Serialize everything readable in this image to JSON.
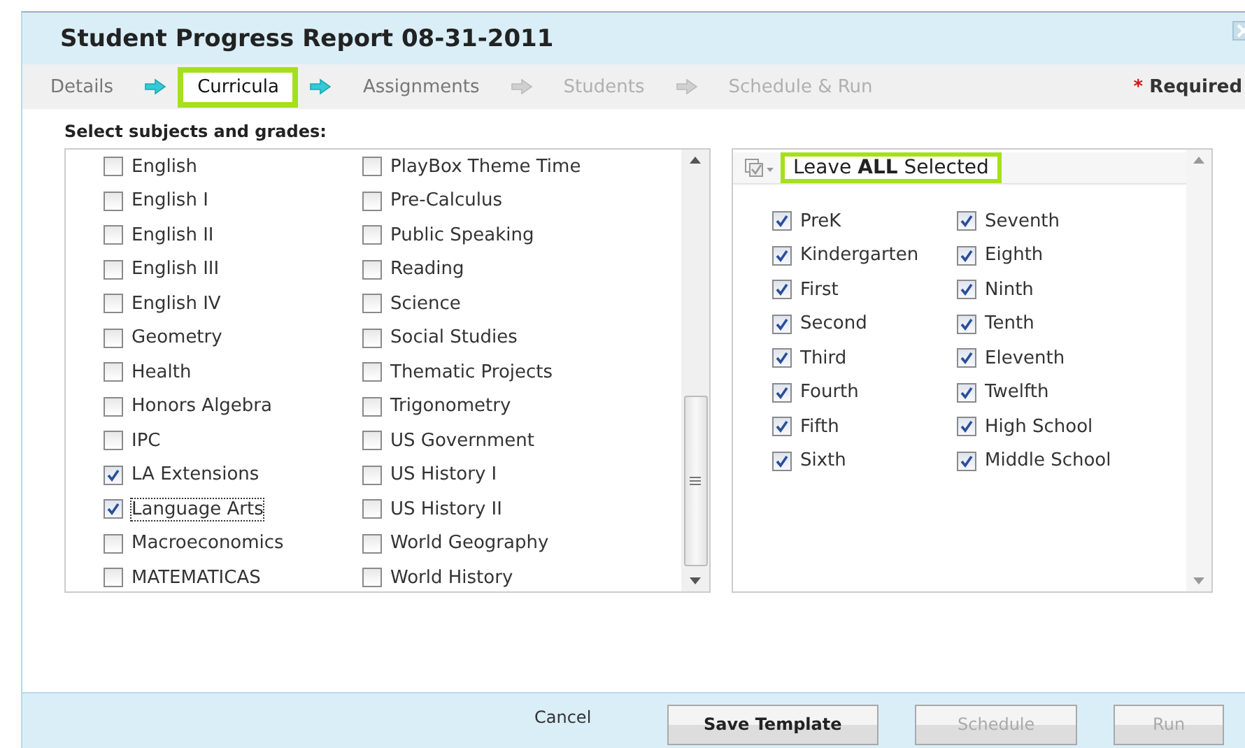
{
  "window": {
    "title": "Student Progress Report 08-31-2011"
  },
  "steps": [
    {
      "label": "Details",
      "enabled": true,
      "selected": false
    },
    {
      "label": "Curricula",
      "enabled": true,
      "selected": true
    },
    {
      "label": "Assignments",
      "enabled": true,
      "selected": false
    },
    {
      "label": "Students",
      "enabled": false,
      "selected": false
    },
    {
      "label": "Schedule & Run",
      "enabled": false,
      "selected": false
    }
  ],
  "required": {
    "mark": "*",
    "label": "Required"
  },
  "prompt": "Select subjects and grades:",
  "subjects": [
    {
      "label": "English",
      "checked": false,
      "focused": false
    },
    {
      "label": "English I",
      "checked": false,
      "focused": false
    },
    {
      "label": "English II",
      "checked": false,
      "focused": false
    },
    {
      "label": "English III",
      "checked": false,
      "focused": false
    },
    {
      "label": "English IV",
      "checked": false,
      "focused": false
    },
    {
      "label": "Geometry",
      "checked": false,
      "focused": false
    },
    {
      "label": "Health",
      "checked": false,
      "focused": false
    },
    {
      "label": "Honors Algebra",
      "checked": false,
      "focused": false
    },
    {
      "label": "IPC",
      "checked": false,
      "focused": false
    },
    {
      "label": "LA Extensions",
      "checked": true,
      "focused": false
    },
    {
      "label": "Language Arts",
      "checked": true,
      "focused": true
    },
    {
      "label": "Macroeconomics",
      "checked": false,
      "focused": false
    },
    {
      "label": "MATEMATICAS",
      "checked": false,
      "focused": false
    },
    {
      "label": "PlayBox Theme Time",
      "checked": false,
      "focused": false
    },
    {
      "label": "Pre-Calculus",
      "checked": false,
      "focused": false
    },
    {
      "label": "Public Speaking",
      "checked": false,
      "focused": false
    },
    {
      "label": "Reading",
      "checked": false,
      "focused": false
    },
    {
      "label": "Science",
      "checked": false,
      "focused": false
    },
    {
      "label": "Social Studies",
      "checked": false,
      "focused": false
    },
    {
      "label": "Thematic Projects",
      "checked": false,
      "focused": false
    },
    {
      "label": "Trigonometry",
      "checked": false,
      "focused": false
    },
    {
      "label": "US Government",
      "checked": false,
      "focused": false
    },
    {
      "label": "US History I",
      "checked": false,
      "focused": false
    },
    {
      "label": "US History II",
      "checked": false,
      "focused": false
    },
    {
      "label": "World Geography",
      "checked": false,
      "focused": false
    },
    {
      "label": "World History",
      "checked": false,
      "focused": false
    }
  ],
  "grades_header": "Leave **ALL** Selected",
  "grades": [
    {
      "label": "PreK",
      "checked": true
    },
    {
      "label": "Kindergarten",
      "checked": true
    },
    {
      "label": "First",
      "checked": true
    },
    {
      "label": "Second",
      "checked": true
    },
    {
      "label": "Third",
      "checked": true
    },
    {
      "label": "Fourth",
      "checked": true
    },
    {
      "label": "Fifth",
      "checked": true
    },
    {
      "label": "Sixth",
      "checked": true
    },
    {
      "label": "Seventh",
      "checked": true
    },
    {
      "label": "Eighth",
      "checked": true
    },
    {
      "label": "Ninth",
      "checked": true
    },
    {
      "label": "Tenth",
      "checked": true
    },
    {
      "label": "Eleventh",
      "checked": true
    },
    {
      "label": "Twelfth",
      "checked": true
    },
    {
      "label": "High School",
      "checked": true
    },
    {
      "label": "Middle School",
      "checked": true
    }
  ],
  "buttons": [
    {
      "label": "Cancel",
      "kind": "link"
    },
    {
      "label": "Save Template",
      "kind": "button",
      "disabled": false
    },
    {
      "label": "Schedule",
      "kind": "button",
      "disabled": true
    },
    {
      "label": "Run",
      "kind": "button",
      "disabled": true
    }
  ]
}
